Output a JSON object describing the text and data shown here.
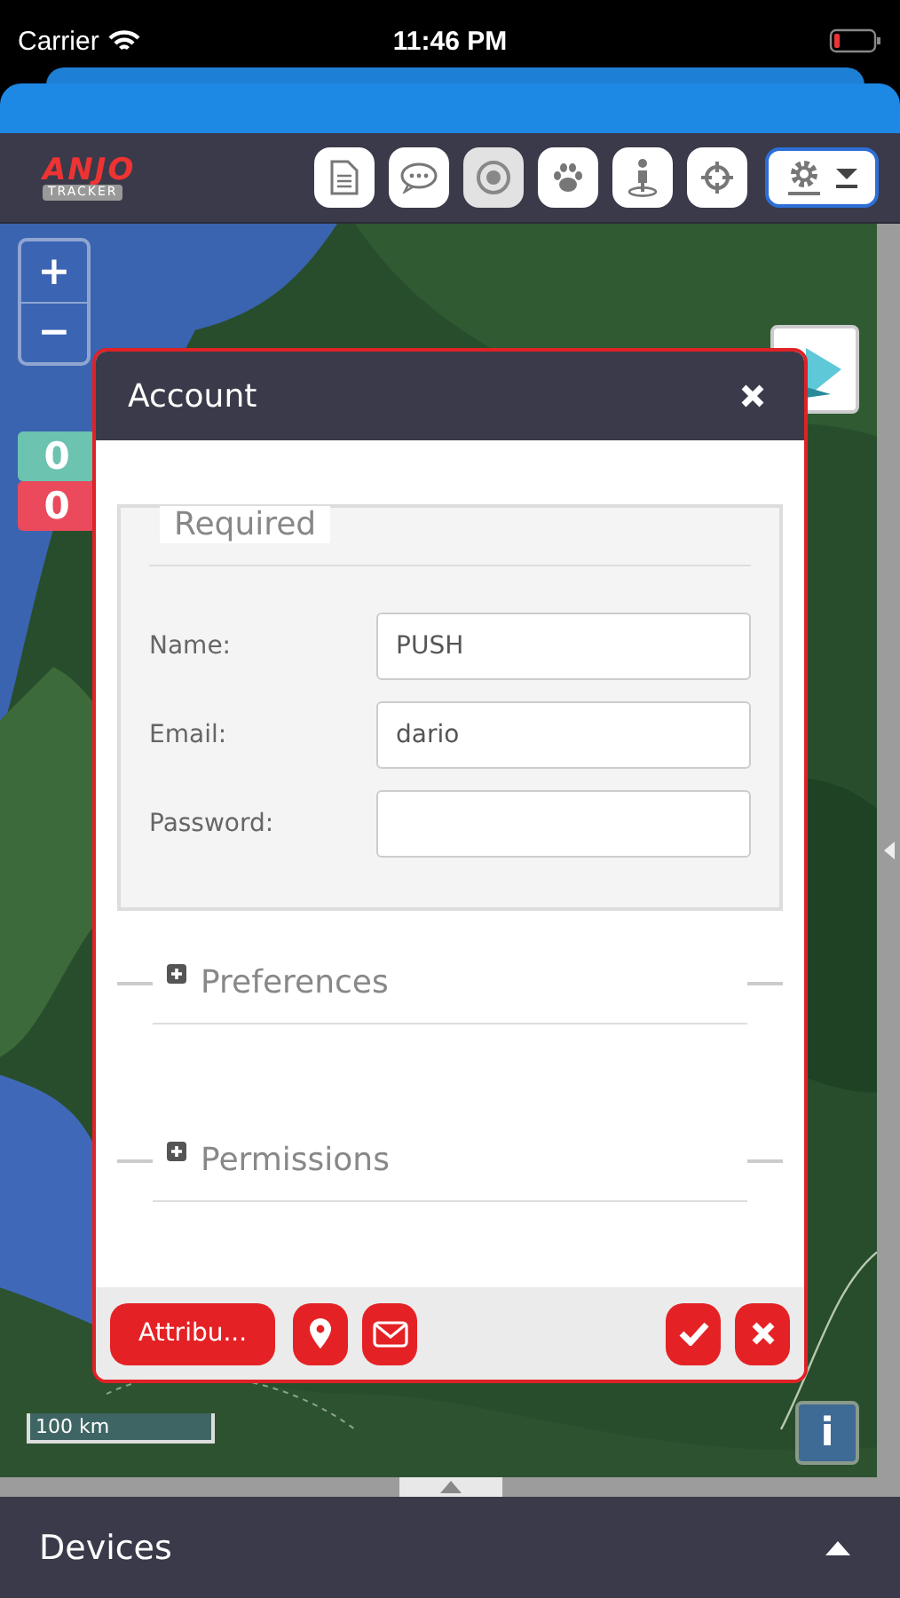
{
  "status_bar": {
    "carrier": "Carrier",
    "time": "11:46 PM"
  },
  "logo": {
    "wordmark": "ANJO",
    "tagline": "TRACKER"
  },
  "toolbar": {
    "buttons": [
      {
        "kind": "report",
        "selected": false
      },
      {
        "kind": "chat",
        "selected": false
      },
      {
        "kind": "target",
        "selected": true
      },
      {
        "kind": "paw",
        "selected": false
      },
      {
        "kind": "person",
        "selected": false
      },
      {
        "kind": "crosshair",
        "selected": false
      }
    ]
  },
  "map": {
    "zoom_in": "+",
    "zoom_out": "−",
    "counters": [
      {
        "value": "0",
        "color": "#6cc3b0"
      },
      {
        "value": "0",
        "color": "#ea4a5c"
      }
    ],
    "scale": "100 km",
    "info": "i"
  },
  "dialog": {
    "title": "Account",
    "sections": [
      {
        "title": "Required",
        "expanded": true,
        "fields": [
          {
            "label": "Name:",
            "value": "PUSH"
          },
          {
            "label": "Email:",
            "value": "dario"
          },
          {
            "label": "Password:"
          }
        ]
      },
      {
        "title": "Preferences",
        "expanded": false
      },
      {
        "title": "Permissions",
        "expanded": false
      }
    ],
    "footer_buttons": [
      {
        "kind": "text",
        "label": "Attribu..."
      },
      {
        "kind": "pin"
      },
      {
        "kind": "mail"
      },
      {
        "kind": "check"
      },
      {
        "kind": "cancel"
      }
    ]
  },
  "bottom_panel": {
    "title": "Devices",
    "expanded": false
  }
}
